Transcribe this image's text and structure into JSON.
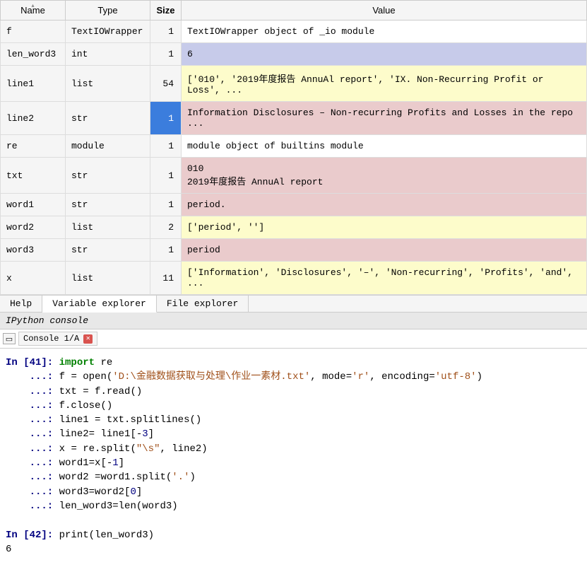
{
  "columns": {
    "name": "Name",
    "type": "Type",
    "size": "Size",
    "value": "Value"
  },
  "rows": [
    {
      "name": "f",
      "type": "TextIOWrapper",
      "size": "1",
      "value": "TextIOWrapper object of _io module",
      "hl": ""
    },
    {
      "name": "len_word3",
      "type": "int",
      "size": "1",
      "value": "6",
      "hl": "blue"
    },
    {
      "name": "line1",
      "type": "list",
      "size": "54",
      "value": "['010', '2019年度报告 AnnuAl report', 'IX. Non-Recurring Profit or Loss', ...",
      "hl": "yellow"
    },
    {
      "name": "line2",
      "type": "str",
      "size": "1",
      "value": "Information Disclosures – Non-recurring Profits and Losses in the repo\n...",
      "hl": "pink",
      "size_selected": true
    },
    {
      "name": "re",
      "type": "module",
      "size": "1",
      "value": "module object of builtins module",
      "hl": ""
    },
    {
      "name": "txt",
      "type": "str",
      "size": "1",
      "value": "010\n2019年度报告 AnnuAl report",
      "hl": "pink"
    },
    {
      "name": "word1",
      "type": "str",
      "size": "1",
      "value": "period.",
      "hl": "pink"
    },
    {
      "name": "word2",
      "type": "list",
      "size": "2",
      "value": "['period', '']",
      "hl": "yellow"
    },
    {
      "name": "word3",
      "type": "str",
      "size": "1",
      "value": "period",
      "hl": "pink"
    },
    {
      "name": "x",
      "type": "list",
      "size": "11",
      "value": "['Information', 'Disclosures', '–', 'Non-recurring', 'Profits', 'and', ...",
      "hl": "yellow"
    }
  ],
  "tabs": {
    "help": "Help",
    "varexp": "Variable explorer",
    "fileexp": "File explorer"
  },
  "ipython_header": "IPython console",
  "console_tab": "Console 1/A",
  "code": {
    "in41": "In [41]: ",
    "in42": "In [42]: ",
    "cont": "    ...: ",
    "l1a": "import",
    "l1b": " re",
    "l2a": "f ",
    "l2b": "=",
    "l2c": " open(",
    "l2d": "'D:\\金融数据获取与处理\\作业一素材.txt'",
    "l2e": ", mode",
    "l2f": "=",
    "l2g": "'r'",
    "l2h": ", encoding",
    "l2i": "=",
    "l2j": "'utf-8'",
    "l2k": ")",
    "l3a": "txt ",
    "l3b": "=",
    "l3c": " f.read()",
    "l4": "f.close()",
    "l5a": "line1 ",
    "l5b": "=",
    "l5c": " txt.splitlines()",
    "l6a": "line2",
    "l6b": "=",
    "l6c": " line1[",
    "l6d": "-",
    "l6e": "3",
    "l6f": "]",
    "l7a": "x ",
    "l7b": "=",
    "l7c": " re.split(",
    "l7d": "\"\\s\"",
    "l7e": ", line2)",
    "l8a": "word1",
    "l8b": "=",
    "l8c": "x[",
    "l8d": "-",
    "l8e": "1",
    "l8f": "]",
    "l9a": "word2 ",
    "l9b": "=",
    "l9c": "word1.split(",
    "l9d": "'.'",
    "l9e": ")",
    "l10a": "word3",
    "l10b": "=",
    "l10c": "word2[",
    "l10d": "0",
    "l10e": "]",
    "l11a": "len_word3",
    "l11b": "=",
    "l11c": "len(word3)",
    "l12": "print(len_word3)",
    "out": "6"
  }
}
